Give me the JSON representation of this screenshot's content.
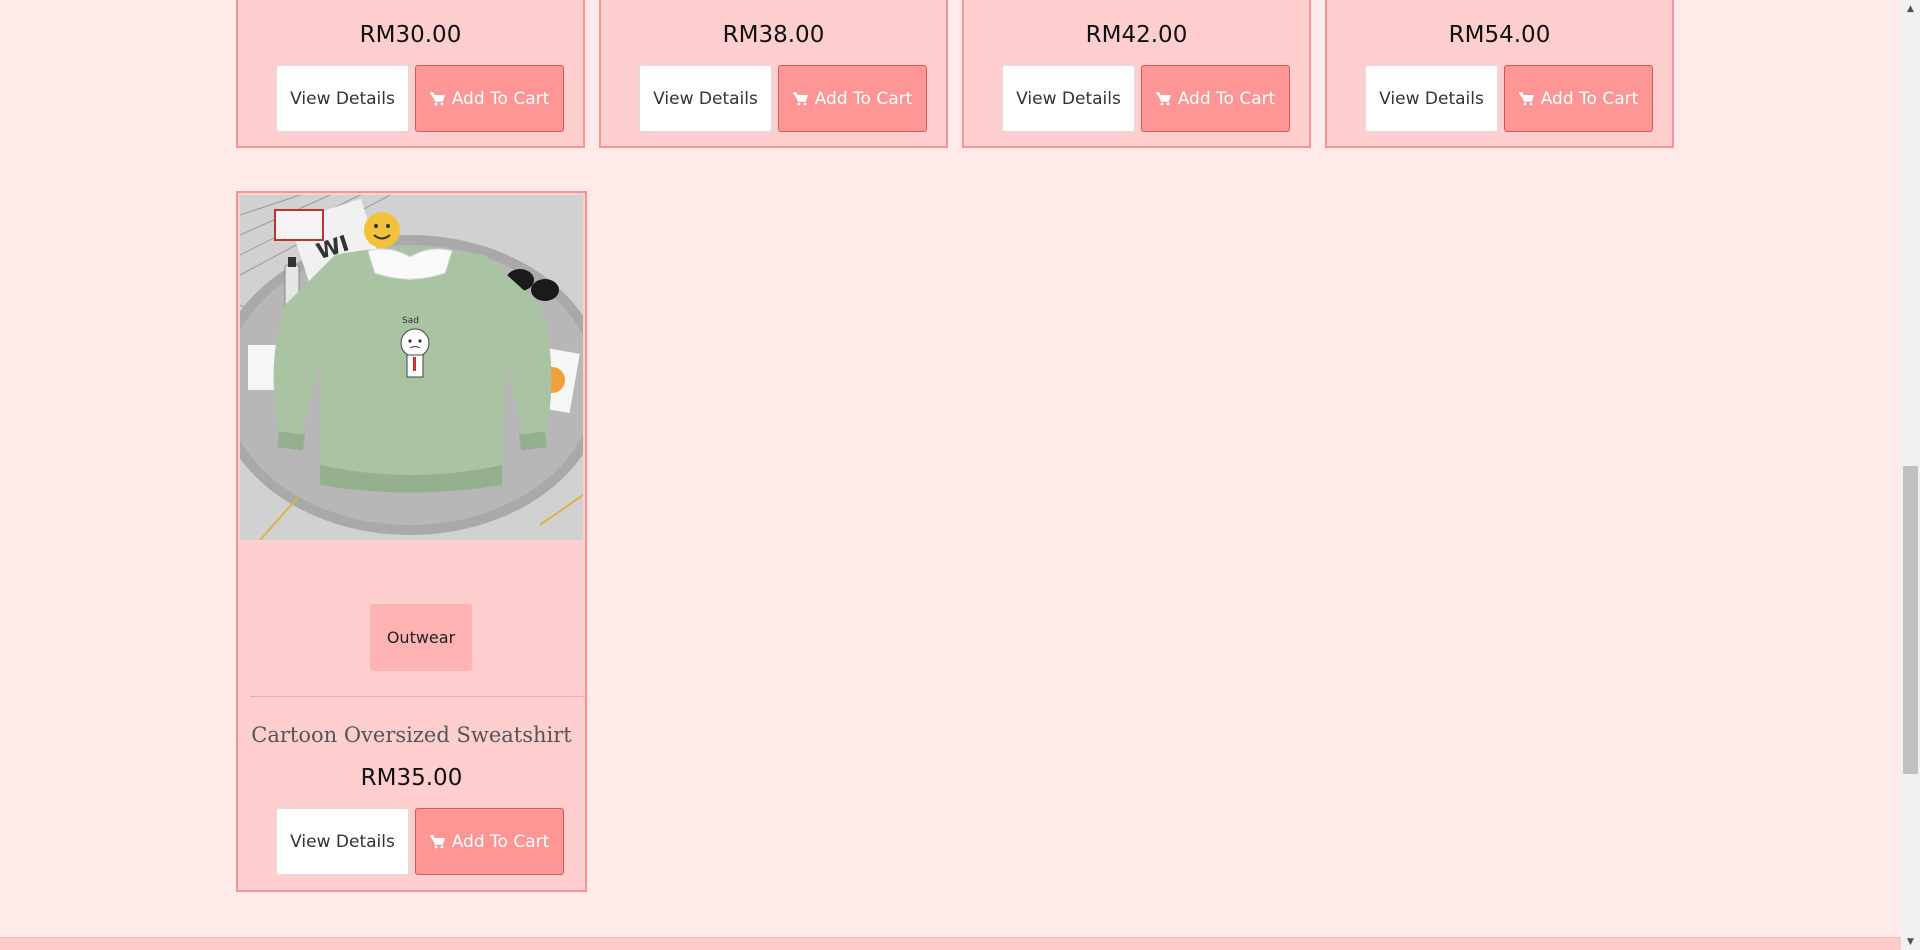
{
  "buttons": {
    "view_details": "View Details",
    "add_to_cart": "Add To Cart"
  },
  "top_products": [
    {
      "price": "RM30.00"
    },
    {
      "price": "RM38.00"
    },
    {
      "price": "RM42.00"
    },
    {
      "price": "RM54.00"
    }
  ],
  "featured_product": {
    "category": "Outwear",
    "name": "Cartoon Oversized Sweatshirt",
    "price": "RM35.00"
  },
  "icons": {
    "cart": "shopping-cart-icon",
    "scroll_up": "scroll-up-arrow-icon",
    "scroll_down": "scroll-down-arrow-icon"
  },
  "colors": {
    "page_background": "#ffeaea",
    "card_background": "#ffcfcf",
    "card_border": "#f59494",
    "cart_button": "#ff9696",
    "category_badge": "#ffb3b3"
  }
}
